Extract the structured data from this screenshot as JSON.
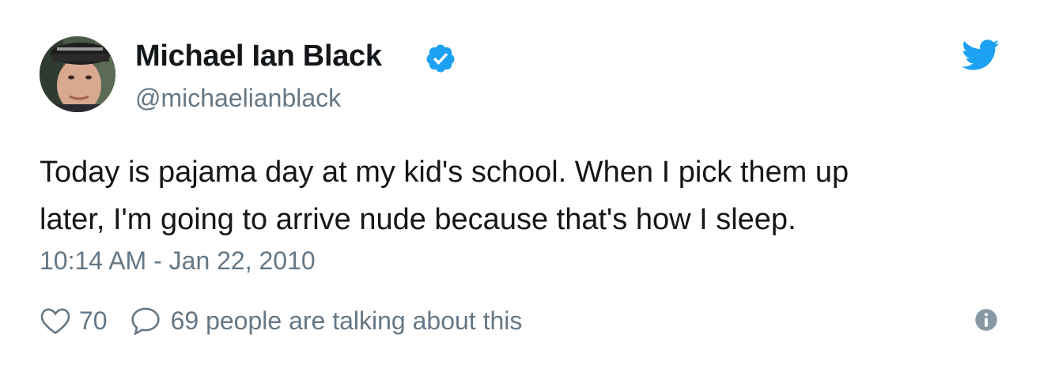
{
  "author": {
    "name": "Michael Ian Black",
    "handle": "@michaelianblack",
    "verified": true,
    "avatar_icon": "profile-photo"
  },
  "tweet": {
    "text_lines": [
      "Today is pajama day at my kid's school. When I pick them up",
      "later, I'm going to arrive nude because that's how I sleep."
    ],
    "timestamp": "10:14 AM - Jan 22, 2010"
  },
  "actions": {
    "like_count": "70",
    "talking_text": "69 people are talking about this"
  },
  "icons": {
    "brand": "twitter-bird-icon",
    "verified": "verified-badge-icon",
    "like": "heart-icon",
    "reply": "speech-bubble-icon",
    "info": "info-icon"
  },
  "colors": {
    "brand_blue": "#1da1f2",
    "text_primary": "#14171a",
    "text_secondary": "#657786"
  }
}
